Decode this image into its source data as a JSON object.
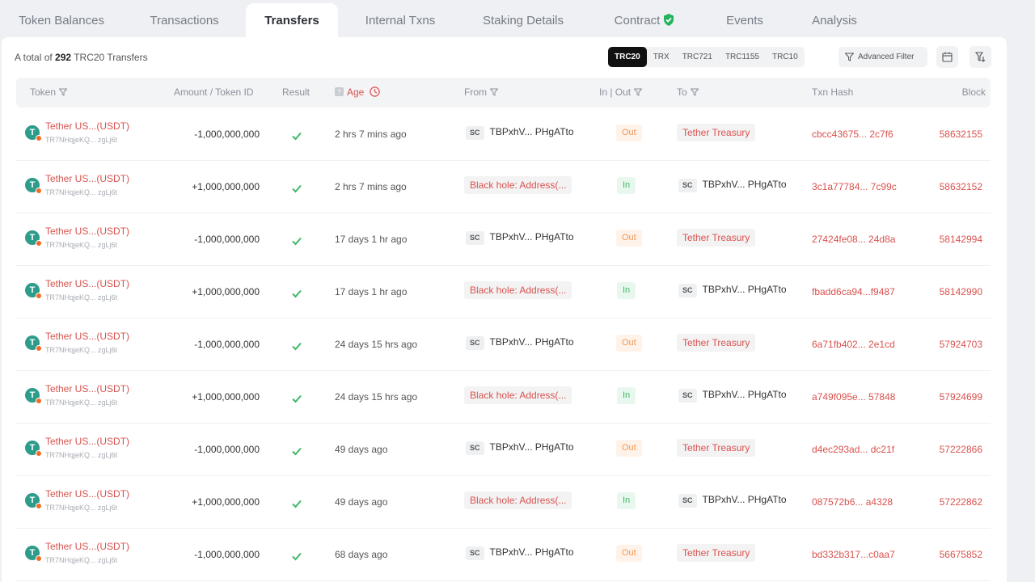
{
  "tabs": [
    {
      "label": "Token Balances"
    },
    {
      "label": "Transactions"
    },
    {
      "label": "Transfers"
    },
    {
      "label": "Internal Txns"
    },
    {
      "label": "Staking Details"
    },
    {
      "label": "Contract"
    },
    {
      "label": "Events"
    },
    {
      "label": "Analysis"
    }
  ],
  "active_tab": "Transfers",
  "summary": {
    "prefix": "A total of",
    "count": "292",
    "suffix": "TRC20 Transfers"
  },
  "filters": {
    "types": [
      "TRC20",
      "TRX",
      "TRC721",
      "TRC1155",
      "TRC10"
    ],
    "selected": "TRC20",
    "advanced_label": "Advanced Filter"
  },
  "columns": {
    "token": "Token",
    "amount": "Amount / Token ID",
    "result": "Result",
    "age": "Age",
    "from": "From",
    "inout": "In | Out",
    "to": "To",
    "hash": "Txn Hash",
    "block": "Block"
  },
  "icons": {
    "token": "tether-icon",
    "filter": "funnel-icon",
    "result": "checkmark-icon",
    "calendar": "calendar-icon",
    "export": "export-icon",
    "verified": "shield-check-icon",
    "age_help": "question-icon",
    "age_toggle": "clock-icon"
  },
  "colors": {
    "accent": "#d9524e",
    "out": "#f29553",
    "in": "#3fb868",
    "tether": "#2e9c8b",
    "verified": "#22b35e"
  },
  "rows": [
    {
      "token": "Tether US...(USDT)",
      "token_addr": "TR7NHqjeKQ... zgLj6t",
      "amount": "-1,000,000,000",
      "age": "2 hrs 7 mins ago",
      "from_sc": "SC",
      "from": "TBPxhV... PHgATto",
      "dir": "Out",
      "to_sc": "",
      "to": "Tether Treasury",
      "hash": "cbcc43675... 2c7f6",
      "block": "58632155"
    },
    {
      "token": "Tether US...(USDT)",
      "token_addr": "TR7NHqjeKQ... zgLj6t",
      "amount": "+1,000,000,000",
      "age": "2 hrs 7 mins ago",
      "from_sc": "",
      "from": "Black hole: Address(...",
      "dir": "In",
      "to_sc": "SC",
      "to": "TBPxhV... PHgATto",
      "hash": "3c1a77784... 7c99c",
      "block": "58632152"
    },
    {
      "token": "Tether US...(USDT)",
      "token_addr": "TR7NHqjeKQ... zgLj6t",
      "amount": "-1,000,000,000",
      "age": "17 days 1 hr ago",
      "from_sc": "SC",
      "from": "TBPxhV... PHgATto",
      "dir": "Out",
      "to_sc": "",
      "to": "Tether Treasury",
      "hash": "27424fe08... 24d8a",
      "block": "58142994"
    },
    {
      "token": "Tether US...(USDT)",
      "token_addr": "TR7NHqjeKQ... zgLj6t",
      "amount": "+1,000,000,000",
      "age": "17 days 1 hr ago",
      "from_sc": "",
      "from": "Black hole: Address(...",
      "dir": "In",
      "to_sc": "SC",
      "to": "TBPxhV... PHgATto",
      "hash": "fbadd6ca94...f9487",
      "block": "58142990"
    },
    {
      "token": "Tether US...(USDT)",
      "token_addr": "TR7NHqjeKQ... zgLj6t",
      "amount": "-1,000,000,000",
      "age": "24 days 15 hrs ago",
      "from_sc": "SC",
      "from": "TBPxhV... PHgATto",
      "dir": "Out",
      "to_sc": "",
      "to": "Tether Treasury",
      "hash": "6a71fb402... 2e1cd",
      "block": "57924703"
    },
    {
      "token": "Tether US...(USDT)",
      "token_addr": "TR7NHqjeKQ... zgLj6t",
      "amount": "+1,000,000,000",
      "age": "24 days 15 hrs ago",
      "from_sc": "",
      "from": "Black hole: Address(...",
      "dir": "In",
      "to_sc": "SC",
      "to": "TBPxhV... PHgATto",
      "hash": "a749f095e... 57848",
      "block": "57924699"
    },
    {
      "token": "Tether US...(USDT)",
      "token_addr": "TR7NHqjeKQ... zgLj6t",
      "amount": "-1,000,000,000",
      "age": "49 days ago",
      "from_sc": "SC",
      "from": "TBPxhV... PHgATto",
      "dir": "Out",
      "to_sc": "",
      "to": "Tether Treasury",
      "hash": "d4ec293ad... dc21f",
      "block": "57222866"
    },
    {
      "token": "Tether US...(USDT)",
      "token_addr": "TR7NHqjeKQ... zgLj6t",
      "amount": "+1,000,000,000",
      "age": "49 days ago",
      "from_sc": "",
      "from": "Black hole: Address(...",
      "dir": "In",
      "to_sc": "SC",
      "to": "TBPxhV... PHgATto",
      "hash": "087572b6... a4328",
      "block": "57222862"
    },
    {
      "token": "Tether US...(USDT)",
      "token_addr": "TR7NHqjeKQ... zgLj6t",
      "amount": "-1,000,000,000",
      "age": "68 days ago",
      "from_sc": "SC",
      "from": "TBPxhV... PHgATto",
      "dir": "Out",
      "to_sc": "",
      "to": "Tether Treasury",
      "hash": "bd332b317...c0aa7",
      "block": "56675852"
    }
  ]
}
